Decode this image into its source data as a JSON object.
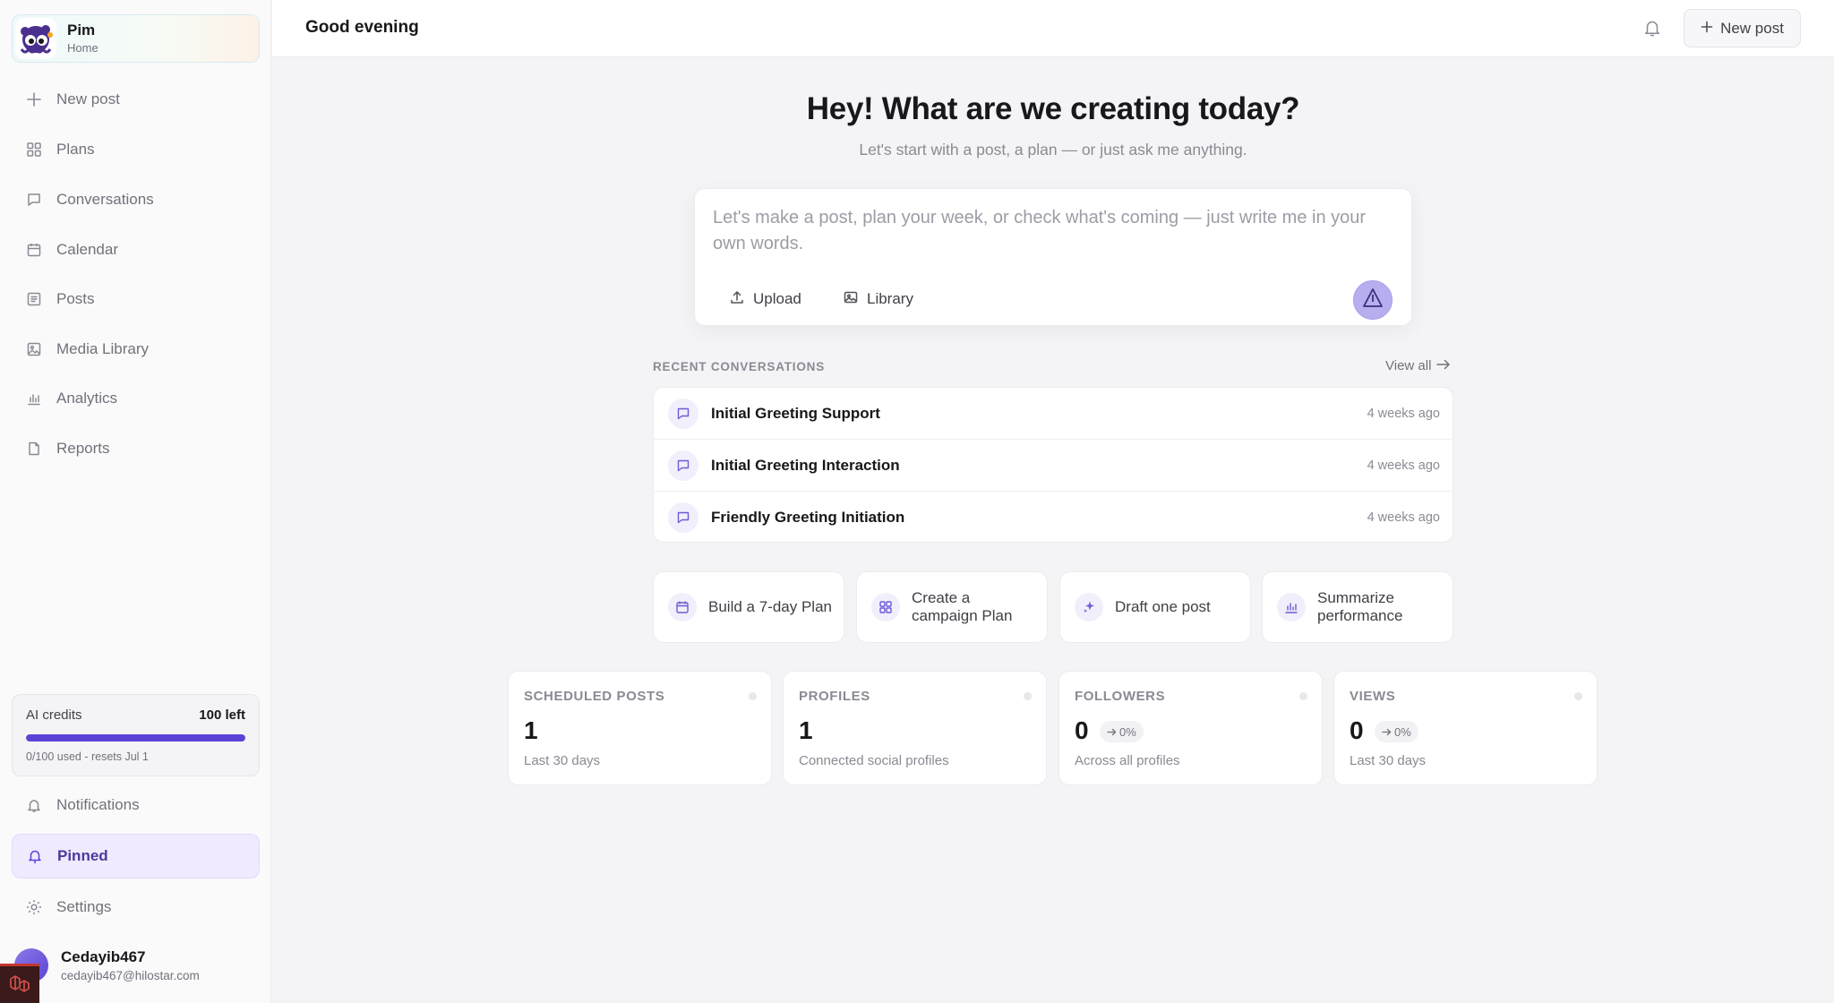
{
  "workspace": {
    "name": "Pim",
    "subtitle": "Home"
  },
  "sidebar": {
    "items": [
      {
        "label": "New post",
        "icon": "plus-icon"
      },
      {
        "label": "Plans",
        "icon": "grid-icon"
      },
      {
        "label": "Conversations",
        "icon": "chat-bubble-icon"
      },
      {
        "label": "Calendar",
        "icon": "calendar-icon"
      },
      {
        "label": "Posts",
        "icon": "list-doc-icon"
      },
      {
        "label": "Media Library",
        "icon": "image-icon"
      },
      {
        "label": "Analytics",
        "icon": "bar-chart-icon"
      },
      {
        "label": "Reports",
        "icon": "file-icon"
      }
    ],
    "bottom_items": [
      {
        "label": "Notifications",
        "icon": "bell-icon"
      },
      {
        "label": "Pinned",
        "icon": "pin-icon",
        "active": true
      },
      {
        "label": "Settings",
        "icon": "gear-icon"
      }
    ]
  },
  "credits": {
    "title": "AI credits",
    "left": "100 left",
    "used_fraction": 1.0,
    "note": "0/100 used - resets Jul 1"
  },
  "user": {
    "name": "Cedayib467",
    "email": "cedayib467@hilostar.com"
  },
  "topbar": {
    "greeting": "Good evening",
    "new_post_label": "New post"
  },
  "hero": {
    "title": "Hey! What are we creating today?",
    "subtitle": "Let's start with a post, a plan — or just ask me anything."
  },
  "composer": {
    "placeholder": "Let's make a post, plan your week, or check what's coming — just write me in your own words.",
    "value": "",
    "upload_label": "Upload",
    "library_label": "Library"
  },
  "recent": {
    "heading": "RECENT CONVERSATIONS",
    "view_all": "View all",
    "items": [
      {
        "title": "Initial Greeting Support",
        "time": "4 weeks ago"
      },
      {
        "title": "Initial Greeting Interaction",
        "time": "4 weeks ago"
      },
      {
        "title": "Friendly Greeting Initiation",
        "time": "4 weeks ago"
      }
    ]
  },
  "actions": [
    {
      "label": "Build a 7-day Plan",
      "icon": "calendar-icon"
    },
    {
      "label": "Create a campaign Plan",
      "icon": "grid-icon"
    },
    {
      "label": "Draft one post",
      "icon": "sparkle-icon"
    },
    {
      "label": "Summarize performance",
      "icon": "bar-chart-icon"
    }
  ],
  "stats": [
    {
      "label": "SCHEDULED POSTS",
      "value": "1",
      "change": "",
      "note": "Last 30 days"
    },
    {
      "label": "PROFILES",
      "value": "1",
      "change": "",
      "note": "Connected social profiles"
    },
    {
      "label": "FOLLOWERS",
      "value": "0",
      "change": "0%",
      "note": "Across all profiles"
    },
    {
      "label": "VIEWS",
      "value": "0",
      "change": "0%",
      "note": "Last 30 days"
    }
  ],
  "colors": {
    "accent": "#5b43d6",
    "accent_soft": "#efeafd",
    "send_button": "#b7aef0"
  }
}
